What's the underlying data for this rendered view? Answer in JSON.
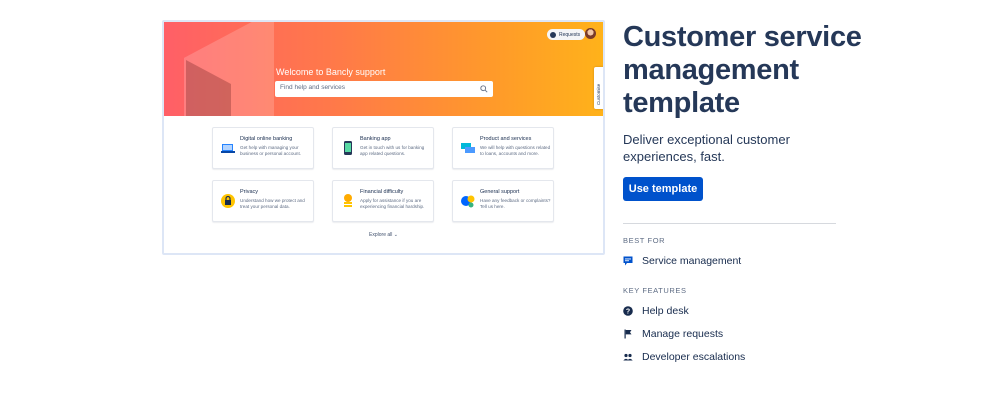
{
  "preview": {
    "hero_title": "Welcome to Bancly support",
    "search_placeholder": "Find help and services",
    "requests_label": "Requests",
    "customise_label": "Customise",
    "explore_label": "Explore all",
    "cards": [
      {
        "title": "Digital online banking",
        "desc": "Get help with managing your business or personal account.",
        "icon": "laptop-icon"
      },
      {
        "title": "Banking app",
        "desc": "Get in touch with us for banking app related questions.",
        "icon": "phone-icon"
      },
      {
        "title": "Product and services",
        "desc": "We will help with questions related to loans, accounts and more.",
        "icon": "cards-icon"
      },
      {
        "title": "Privacy",
        "desc": "Understand how we protect and treat your personal data.",
        "icon": "lock-icon"
      },
      {
        "title": "Financial difficulty",
        "desc": "Apply for assistance if you are experiencing financial hardship.",
        "icon": "coins-icon"
      },
      {
        "title": "General support",
        "desc": "Have any feedback or complaints? Tell us here.",
        "icon": "support-icon"
      }
    ]
  },
  "info": {
    "title": "Customer service management template",
    "subtitle": "Deliver exceptional customer experiences, fast.",
    "cta_label": "Use template",
    "best_for_label": "BEST FOR",
    "best_for": [
      {
        "label": "Service management",
        "icon": "chat-icon"
      }
    ],
    "key_features_label": "KEY FEATURES",
    "features": [
      {
        "label": "Help desk",
        "icon": "question-icon"
      },
      {
        "label": "Manage requests",
        "icon": "flag-icon"
      },
      {
        "label": "Developer escalations",
        "icon": "people-icon"
      }
    ]
  },
  "colors": {
    "primary": "#0052cc",
    "heading": "#253858",
    "hero_start": "#ff5f67",
    "hero_end": "#ffb21a"
  }
}
